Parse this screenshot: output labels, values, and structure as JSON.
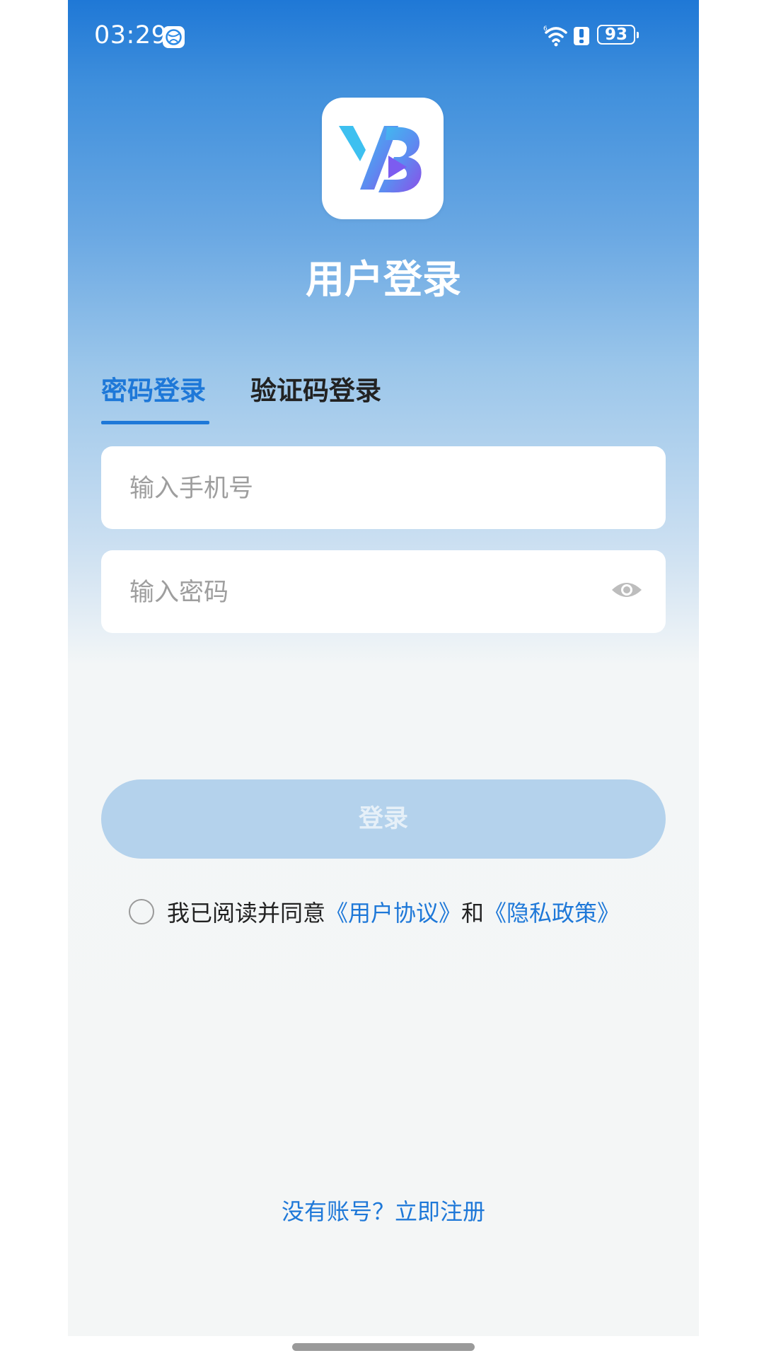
{
  "status_bar": {
    "time": "03:29",
    "battery": "93",
    "icons": [
      "globe-app-icon",
      "wifi-icon",
      "alert-icon",
      "battery-icon"
    ]
  },
  "app": {
    "logo_icon": "yb-play-logo",
    "title": "用户登录"
  },
  "tabs": [
    {
      "label": "密码登录",
      "active": true
    },
    {
      "label": "验证码登录",
      "active": false
    }
  ],
  "form": {
    "phone_placeholder": "输入手机号",
    "phone_value": "",
    "password_placeholder": "输入密码",
    "password_value": "",
    "password_toggle_icon": "eye-icon"
  },
  "login_button": {
    "label": "登录"
  },
  "agreement": {
    "checked": false,
    "prefix": "我已阅读并同意",
    "user_agreement": "《用户协议》",
    "conjunction": "和",
    "privacy_policy": "《隐私政策》"
  },
  "register": {
    "label": "没有账号？立即注册"
  },
  "colors": {
    "primary": "#1e78d8",
    "button_disabled": "#b4d2ec",
    "background": "#f4f6f6"
  }
}
